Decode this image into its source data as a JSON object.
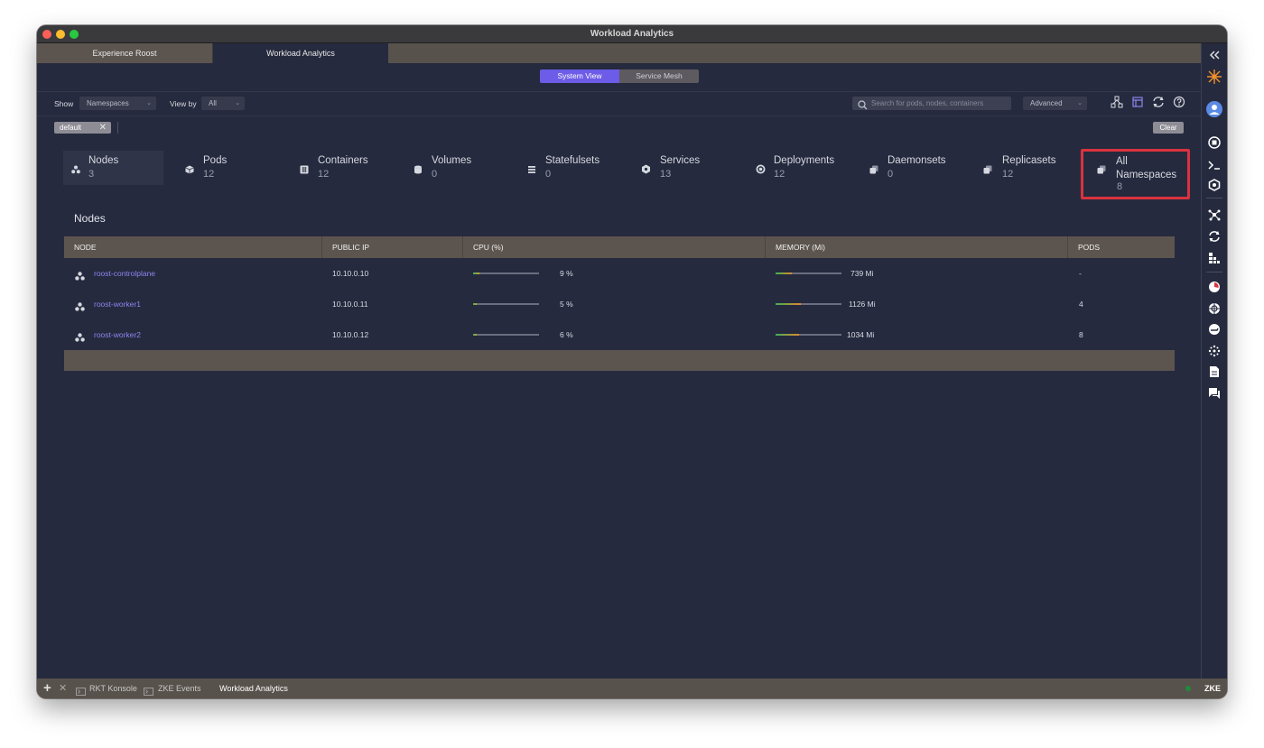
{
  "window": {
    "title": "Workload Analytics"
  },
  "tabs": [
    {
      "label": "Experience Roost"
    },
    {
      "label": "Workload Analytics"
    }
  ],
  "view_toggle": {
    "active": "System View",
    "inactive": "Service Mesh View"
  },
  "filters": {
    "show_label": "Show",
    "show_value": "Namespaces",
    "viewby_label": "View by",
    "viewby_value": "All",
    "search_placeholder": "Search for pods, nodes, containers",
    "advanced_value": "Advanced"
  },
  "chip": {
    "label": "default"
  },
  "clear_label": "Clear",
  "stats": [
    {
      "name": "Nodes",
      "count": "3",
      "icon": "nodes-icon"
    },
    {
      "name": "Pods",
      "count": "12",
      "icon": "cube-icon"
    },
    {
      "name": "Containers",
      "count": "12",
      "icon": "container-icon"
    },
    {
      "name": "Volumes",
      "count": "0",
      "icon": "cylinder-icon"
    },
    {
      "name": "Statefulsets",
      "count": "0",
      "icon": "list-icon"
    },
    {
      "name": "Services",
      "count": "13",
      "icon": "hexagon-icon"
    },
    {
      "name": "Deployments",
      "count": "12",
      "icon": "target-icon"
    },
    {
      "name": "Daemonsets",
      "count": "0",
      "icon": "copy-icon"
    },
    {
      "name": "Replicasets",
      "count": "12",
      "icon": "copy-icon"
    },
    {
      "name": "All Namespaces",
      "count": "8",
      "icon": "copy-icon"
    }
  ],
  "section_title": "Nodes",
  "table": {
    "headers": [
      "NODE",
      "PUBLIC IP",
      "CPU (%)",
      "MEMORY (Mi)",
      "PODS"
    ],
    "rows": [
      {
        "node": "roost-controlplane",
        "ip": "10.10.0.10",
        "cpu": "9 %",
        "cpu_pct": 0.09,
        "memory": "739 Mi",
        "mem_pct": 0.25,
        "pods": "-"
      },
      {
        "node": "roost-worker1",
        "ip": "10.10.0.11",
        "cpu": "5 %",
        "cpu_pct": 0.05,
        "memory": "1126 Mi",
        "mem_pct": 0.38,
        "pods": "4"
      },
      {
        "node": "roost-worker2",
        "ip": "10.10.0.12",
        "cpu": "6 %",
        "cpu_pct": 0.06,
        "memory": "1034 Mi",
        "mem_pct": 0.35,
        "pods": "8"
      }
    ]
  },
  "statusbar": {
    "items": [
      "RKT Konsole",
      "ZKE Events",
      "Workload Analytics"
    ],
    "right_label": "ZKE"
  },
  "colors": {
    "accent": "#6c5ce7",
    "highlight": "#d9333f",
    "bar_fill_cpu": "#c9a227",
    "bar_fill_mem": "#e08a2a",
    "bar_fill_start": "#3fae5c"
  }
}
